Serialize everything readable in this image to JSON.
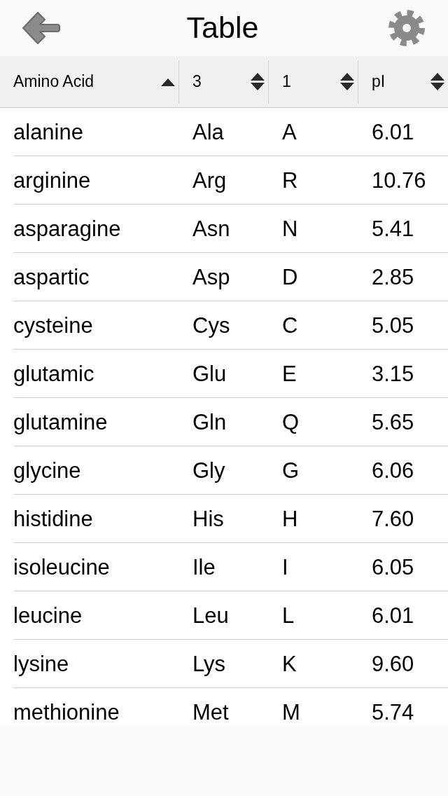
{
  "header": {
    "title": "Table"
  },
  "table": {
    "columns": [
      {
        "label": "Amino Acid",
        "sorted": true
      },
      {
        "label": "3",
        "sorted": false
      },
      {
        "label": "1",
        "sorted": false
      },
      {
        "label": "pI",
        "sorted": false
      }
    ],
    "rows": [
      [
        "alanine",
        "Ala",
        "A",
        "6.01"
      ],
      [
        "arginine",
        "Arg",
        "R",
        "10.76"
      ],
      [
        "asparagine",
        "Asn",
        "N",
        "5.41"
      ],
      [
        "aspartic",
        "Asp",
        "D",
        "2.85"
      ],
      [
        "cysteine",
        "Cys",
        "C",
        "5.05"
      ],
      [
        "glutamic",
        "Glu",
        "E",
        "3.15"
      ],
      [
        "glutamine",
        "Gln",
        "Q",
        "5.65"
      ],
      [
        "glycine",
        "Gly",
        "G",
        "6.06"
      ],
      [
        "histidine",
        "His",
        "H",
        "7.60"
      ],
      [
        "isoleucine",
        "Ile",
        "I",
        "6.05"
      ],
      [
        "leucine",
        "Leu",
        "L",
        "6.01"
      ],
      [
        "lysine",
        "Lys",
        "K",
        "9.60"
      ],
      [
        "methionine",
        "Met",
        "M",
        "5.74"
      ]
    ]
  }
}
